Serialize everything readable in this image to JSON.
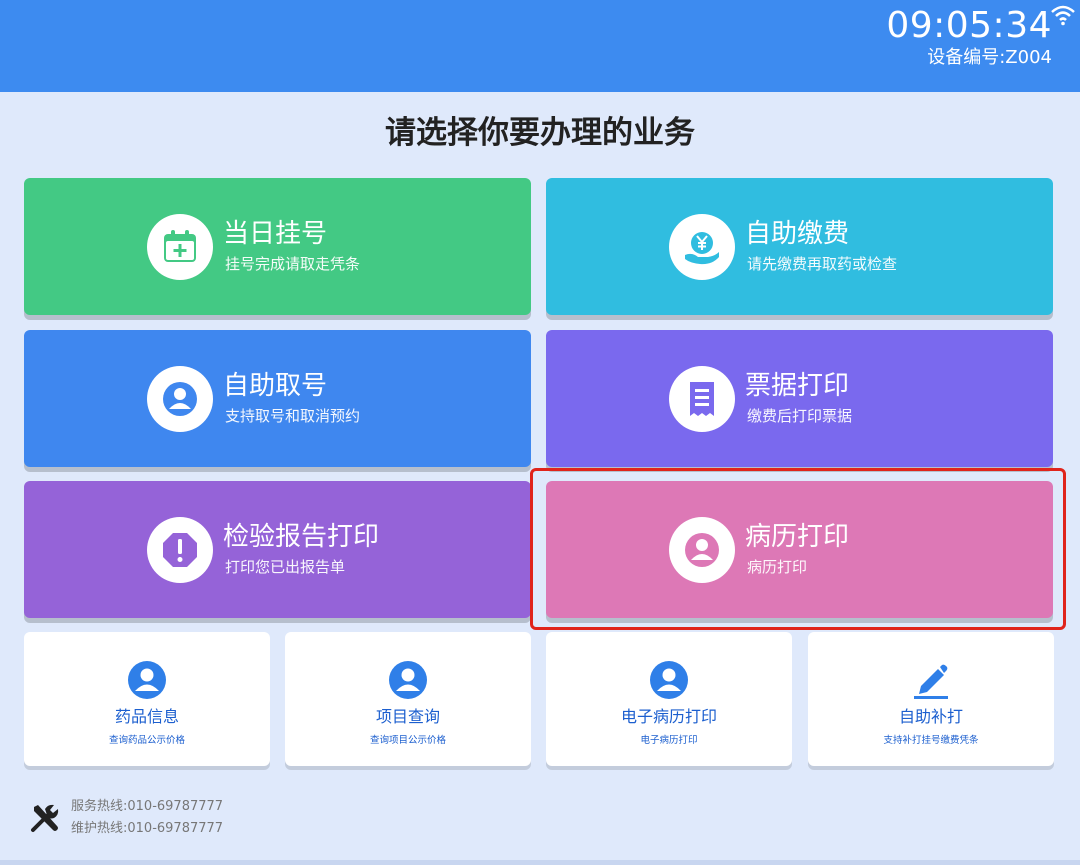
{
  "header": {
    "time": "09:05:34",
    "device": "设备编号:Z004",
    "bar_color": "#3d8bf0",
    "status_icon": "wifi-icon"
  },
  "page_title": "请选择你要办理的业务",
  "tiles": [
    {
      "title": "当日挂号",
      "subtitle": "挂号完成请取走凭条",
      "color": "#43c984",
      "icon": "calendar-plus-icon"
    },
    {
      "title": "自助缴费",
      "subtitle": "请先缴费再取药或检查",
      "color": "#30bde0",
      "icon": "yen-hand-icon"
    },
    {
      "title": "自助取号",
      "subtitle": "支持取号和取消预约",
      "color": "#3f87ef",
      "icon": "user-icon"
    },
    {
      "title": "票据打印",
      "subtitle": "缴费后打印票据",
      "color": "#7a69ee",
      "icon": "receipt-icon"
    },
    {
      "title": "检验报告打印",
      "subtitle": "打印您已出报告单",
      "color": "#9563d8",
      "icon": "alert-octagon-icon"
    },
    {
      "title": "病历打印",
      "subtitle": "病历打印",
      "color": "#dd78b6",
      "icon": "user-icon"
    }
  ],
  "cards": [
    {
      "title": "药品信息",
      "subtitle": "查询药品公示价格",
      "icon": "user-icon"
    },
    {
      "title": "项目查询",
      "subtitle": "查询项目公示价格",
      "icon": "user-icon"
    },
    {
      "title": "电子病历打印",
      "subtitle": "电子病历打印",
      "icon": "user-icon"
    },
    {
      "title": "自助补打",
      "subtitle": "支持补打挂号缴费凭条",
      "icon": "pencil-icon"
    }
  ],
  "footer": {
    "icon": "tools-icon",
    "service_hotline": "服务热线:010-69787777",
    "maintenance_hotline": "维护热线:010-69787777"
  },
  "highlight_color": "#e0241b"
}
